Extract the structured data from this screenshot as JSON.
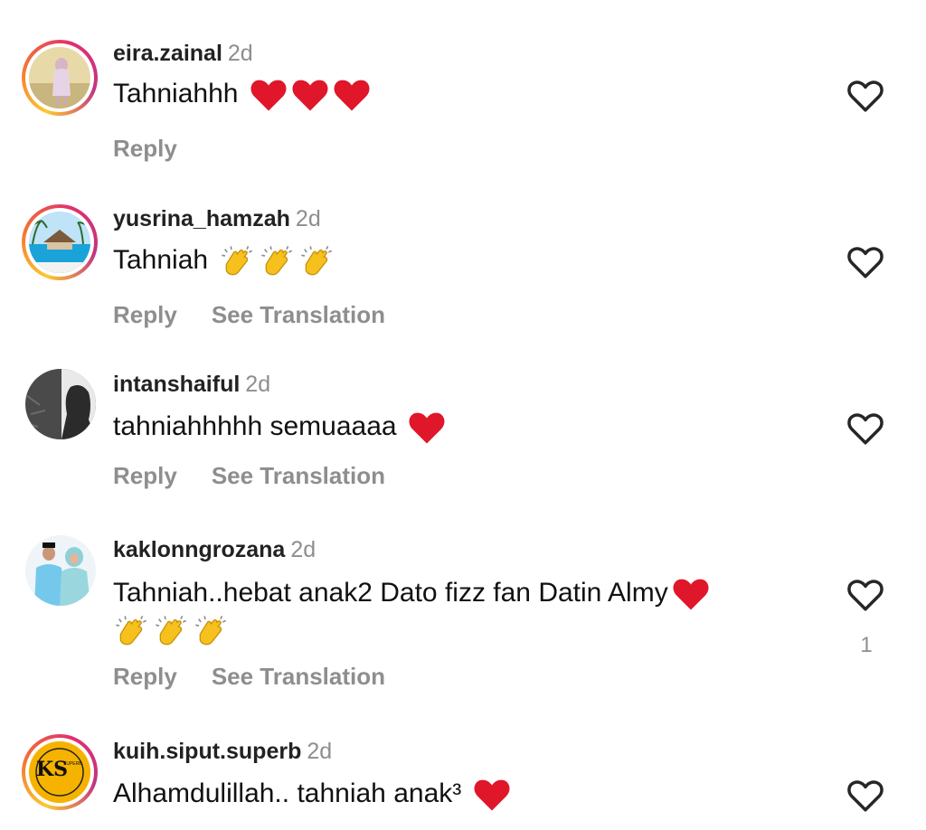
{
  "comments": [
    {
      "username": "eira.zainal",
      "time": "2d",
      "text": "Tahniahhh",
      "emoji": [
        "heart-emoji",
        "heart-emoji",
        "heart-emoji"
      ],
      "reply_label": "Reply",
      "translate_label": "",
      "likes": ""
    },
    {
      "username": "yusrina_hamzah",
      "time": "2d",
      "text": "Tahniah",
      "emoji": [
        "clap-emoji",
        "clap-emoji",
        "clap-emoji"
      ],
      "reply_label": "Reply",
      "translate_label": "See Translation",
      "likes": ""
    },
    {
      "username": "intanshaiful",
      "time": "2d",
      "text": "tahniahhhhh semuaaaa",
      "emoji": [
        "heart-emoji"
      ],
      "reply_label": "Reply",
      "translate_label": "See Translation",
      "likes": ""
    },
    {
      "username": "kaklonngrozana",
      "time": "2d",
      "text": "Tahniah..hebat anak2 Dato fizz fan Datin Almy",
      "emoji": [
        "heart-emoji",
        "clap-emoji",
        "clap-emoji",
        "clap-emoji"
      ],
      "reply_label": "Reply",
      "translate_label": "See Translation",
      "likes": "1"
    },
    {
      "username": "kuih.siput.superb",
      "time": "2d",
      "text": "Alhamdulillah.. tahniah anak³",
      "emoji": [
        "heart-emoji"
      ],
      "reply_label": "",
      "translate_label": "",
      "likes": "",
      "avatar_logo": {
        "main": "KS",
        "small": "SUPERB"
      }
    }
  ],
  "icons": {
    "like": "heart-outline-icon"
  },
  "colors": {
    "heart": "#e0162b",
    "clap": "#f6c11c",
    "muted": "#8e8e8e"
  }
}
